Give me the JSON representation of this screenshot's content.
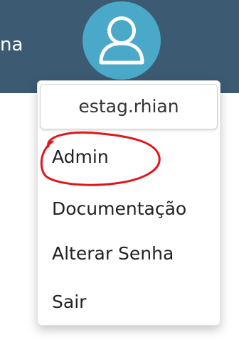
{
  "header": {
    "nav_fragment": "na",
    "avatar_icon": "user-icon",
    "background_color": "#3d5a73",
    "avatar_color": "#4aa9c8"
  },
  "user_menu": {
    "username": "estag.rhian",
    "items": [
      {
        "label": "Admin"
      },
      {
        "label": "Documentação"
      },
      {
        "label": "Alterar Senha"
      },
      {
        "label": "Sair"
      }
    ]
  },
  "annotation": {
    "color": "#e0161b",
    "target": "Admin"
  }
}
